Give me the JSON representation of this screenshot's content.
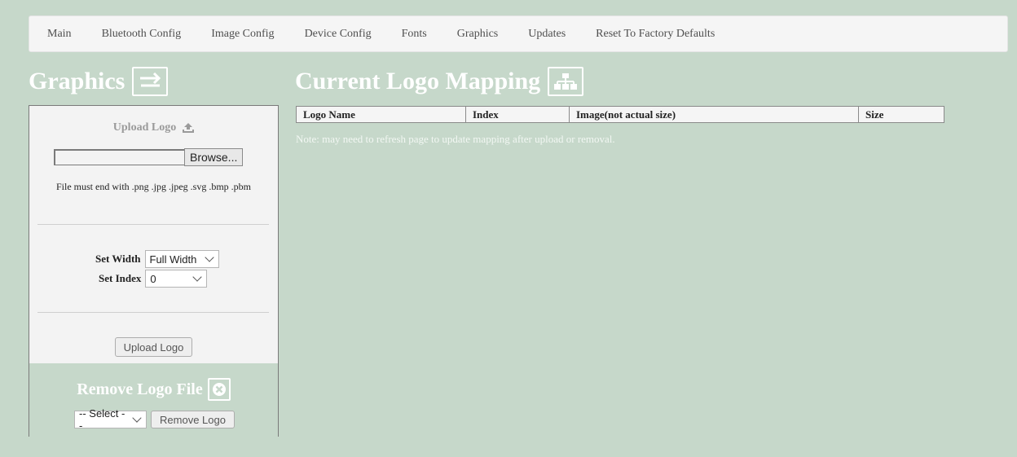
{
  "nav": {
    "items": [
      "Main",
      "Bluetooth Config",
      "Image Config",
      "Device Config",
      "Fonts",
      "Graphics",
      "Updates",
      "Reset To Factory Defaults"
    ]
  },
  "graphics_heading": {
    "label": "Graphics",
    "icon": "swap-arrows-icon"
  },
  "upload": {
    "title": "Upload Logo",
    "title_icon": "upload-icon",
    "file_value": "",
    "browse_label": "Browse...",
    "file_note": "File must end with .png .jpg .jpeg .svg .bmp .pbm",
    "width_label": "Set Width",
    "width_value": "Full Width",
    "index_label": "Set Index",
    "index_value": "0",
    "submit_label": "Upload Logo"
  },
  "remove": {
    "title": "Remove Logo File",
    "title_icon": "remove-circle-icon",
    "select_value": "-- Select --",
    "button_label": "Remove Logo"
  },
  "mapping": {
    "title": "Current Logo Mapping",
    "title_icon": "sitemap-icon",
    "columns": [
      "Logo Name",
      "Index",
      "Image(not actual size)",
      "Size"
    ],
    "rows": [],
    "note": "Note: may need to refresh page to update mapping after upload or removal."
  },
  "colors": {
    "page_bg": "#c6d8ca",
    "panel_bg": "#f3f3f3",
    "nav_bg": "#f5f5f5",
    "heading_text": "#ffffff"
  }
}
